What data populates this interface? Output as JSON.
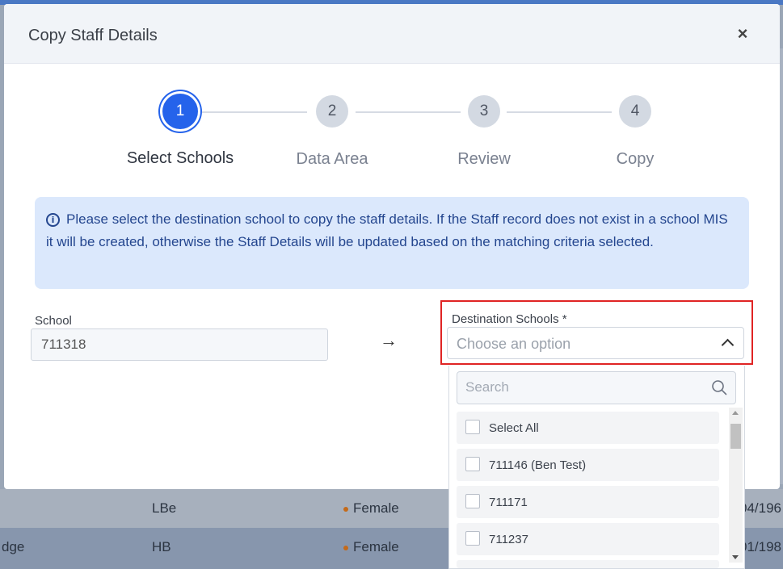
{
  "modal": {
    "title": "Copy Staff Details",
    "close_label": "×"
  },
  "stepper": {
    "steps": [
      {
        "number": "1",
        "label": "Select Schools",
        "active": true
      },
      {
        "number": "2",
        "label": "Data Area",
        "active": false
      },
      {
        "number": "3",
        "label": "Review",
        "active": false
      },
      {
        "number": "4",
        "label": "Copy",
        "active": false
      }
    ]
  },
  "info": {
    "icon": "info-icon",
    "text": "Please select the destination school to copy the staff details. If the Staff record does not exist in a school MIS it will be created, otherwise the Staff Details will be updated based on the matching criteria selected."
  },
  "form": {
    "school_label": "School",
    "school_value": "711318",
    "arrow": "→",
    "destination_label": "Destination Schools *",
    "destination_placeholder": "Choose an option",
    "search_placeholder": "Search",
    "options": [
      "Select All",
      "711146 (Ben Test)",
      "711171",
      "711237"
    ]
  },
  "background_rows": [
    {
      "name_fragment": "",
      "code": "LBe",
      "gender": "Female",
      "date_fragment": "04/196"
    },
    {
      "name_fragment": "dge",
      "code": "HB",
      "gender": "Female",
      "date_fragment": "01/198"
    }
  ],
  "colors": {
    "accent": "#2563eb",
    "info_bg": "#dbe8fc",
    "info_text": "#24468f",
    "highlight_border": "#e02424"
  }
}
